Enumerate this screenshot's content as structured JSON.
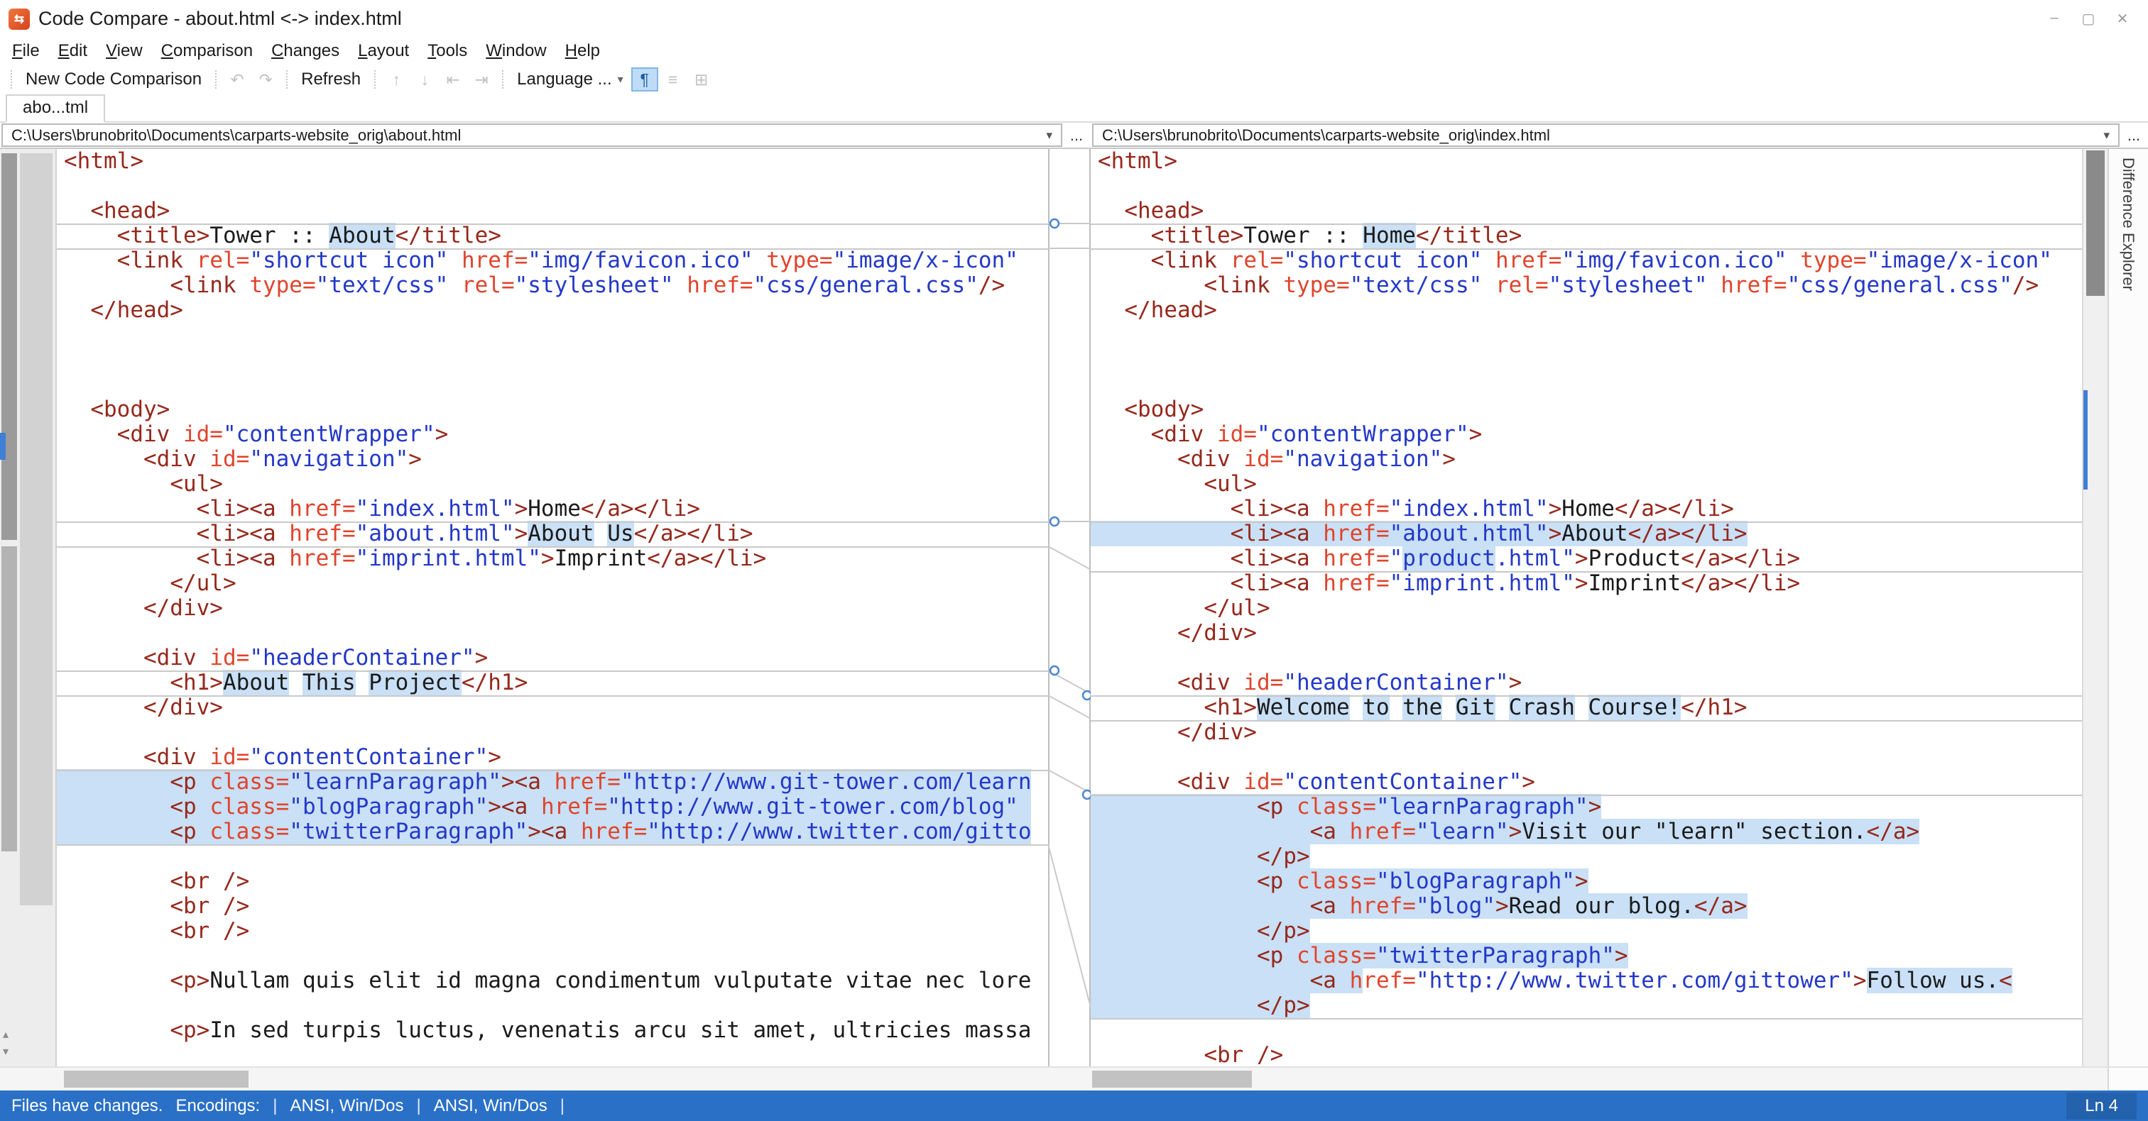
{
  "window": {
    "title": "Code Compare - about.html <-> index.html",
    "controls": [
      {
        "name": "minimize-button",
        "glyph": "–"
      },
      {
        "name": "maximize-button",
        "glyph": "▢"
      },
      {
        "name": "close-button",
        "glyph": "✕"
      }
    ]
  },
  "menu": [
    "File",
    "Edit",
    "View",
    "Comparison",
    "Changes",
    "Layout",
    "Tools",
    "Window",
    "Help"
  ],
  "toolbar": {
    "items": [
      {
        "type": "grip"
      },
      {
        "type": "label",
        "label": "New Code Comparison",
        "name": "new-code-comparison-button"
      },
      {
        "type": "grip"
      },
      {
        "type": "icon",
        "glyph": "↶",
        "name": "undo-icon",
        "state": "disabled"
      },
      {
        "type": "icon",
        "glyph": "↷",
        "name": "redo-icon",
        "state": "disabled"
      },
      {
        "type": "grip"
      },
      {
        "type": "label",
        "label": "Refresh",
        "name": "refresh-button"
      },
      {
        "type": "grip"
      },
      {
        "type": "icon",
        "glyph": "↑",
        "name": "previous-difference-icon",
        "state": "disabled"
      },
      {
        "type": "icon",
        "glyph": "↓",
        "name": "next-difference-icon",
        "state": "disabled"
      },
      {
        "type": "icon",
        "glyph": "⇤",
        "name": "first-difference-icon",
        "state": "disabled"
      },
      {
        "type": "icon",
        "glyph": "⇥",
        "name": "last-difference-icon",
        "state": "disabled"
      },
      {
        "type": "grip"
      },
      {
        "type": "label",
        "label": "Language ...",
        "name": "language-selector",
        "arrow": true
      },
      {
        "type": "icon",
        "glyph": "¶",
        "name": "show-whitespace-icon",
        "state": "active"
      },
      {
        "type": "icon",
        "glyph": "≡",
        "name": "line-details-icon",
        "state": "disabled"
      },
      {
        "type": "icon",
        "glyph": "⊞",
        "name": "structure-comparison-icon",
        "state": "disabled"
      }
    ]
  },
  "tabs": [
    {
      "label": "abo...tml"
    }
  ],
  "controls": {
    "browse_label": "...",
    "combo_arrow": "▾"
  },
  "left_pane": {
    "path": "C:\\Users\\brunobrito\\Documents\\carparts-website_orig\\about.html",
    "lines": [
      "<html>",
      "",
      "  <head>",
      {
        "t": "    <title>Tower :: About</title>",
        "hl": [
          {
            "find": "About"
          }
        ]
      },
      "    <link rel=\"shortcut icon\" href=\"img/favicon.ico\" type=\"image/x-icon\"",
      "        <link type=\"text/css\" rel=\"stylesheet\" href=\"css/general.css\"/>",
      "  </head>",
      "",
      "",
      "",
      "  <body>",
      "    <div id=\"contentWrapper\">",
      "      <div id=\"navigation\">",
      "        <ul>",
      "          <li><a href=\"index.html\">Home</a></li>",
      {
        "t": "          <li><a href=\"about.html\">About Us</a></li>",
        "hl": [
          {
            "words": [
              "About",
              "Us"
            ]
          }
        ]
      },
      "          <li><a href=\"imprint.html\">Imprint</a></li>",
      "        </ul>",
      "      </div>",
      "",
      "      <div id=\"headerContainer\">",
      {
        "t": "        <h1>About This Project</h1>",
        "hl": [
          {
            "words": [
              "About",
              "This",
              "Project"
            ]
          }
        ]
      },
      "      </div>",
      "",
      "      <div id=\"contentContainer\">",
      {
        "t": "        <p class=\"learnParagraph\"><a href=\"http://www.git-tower.com/learn",
        "hl": [
          {
            "full": true
          }
        ]
      },
      {
        "t": "        <p class=\"blogParagraph\"><a href=\"http://www.git-tower.com/blog\" ",
        "hl": [
          {
            "full": true
          }
        ]
      },
      {
        "t": "        <p class=\"twitterParagraph\"><a href=\"http://www.twitter.com/gitto",
        "hl": [
          {
            "full": true
          }
        ]
      },
      "",
      "        <br />",
      "        <br />",
      "        <br />",
      "",
      "        <p>Nullam quis elit id magna condimentum vulputate vitae nec lore",
      "",
      "        <p>In sed turpis luctus, venenatis arcu sit amet, ultricies massa"
    ]
  },
  "right_pane": {
    "path": "C:\\Users\\brunobrito\\Documents\\carparts-website_orig\\index.html",
    "lines": [
      "<html>",
      "",
      "  <head>",
      {
        "t": "    <title>Tower :: Home</title>",
        "hl": [
          {
            "find": "Home"
          }
        ]
      },
      "    <link rel=\"shortcut icon\" href=\"img/favicon.ico\" type=\"image/x-icon\"",
      "        <link type=\"text/css\" rel=\"stylesheet\" href=\"css/general.css\"/>",
      "  </head>",
      "",
      "",
      "",
      "  <body>",
      "    <div id=\"contentWrapper\">",
      "      <div id=\"navigation\">",
      "        <ul>",
      "          <li><a href=\"index.html\">Home</a></li>",
      {
        "t": "          <li><a href=\"about.html\">About</a></li>",
        "hl": [
          {
            "full": true
          }
        ]
      },
      {
        "t": "          <li><a href=\"product.html\">Product</a></li>",
        "hl": [
          {
            "find": "product"
          }
        ]
      },
      "          <li><a href=\"imprint.html\">Imprint</a></li>",
      "        </ul>",
      "      </div>",
      "",
      "      <div id=\"headerContainer\">",
      {
        "t": "        <h1>Welcome to the Git Crash Course!</h1>",
        "hl": [
          {
            "words": [
              "Welcome",
              "to",
              "the",
              "Git",
              "Crash",
              "Course!"
            ]
          }
        ]
      },
      "      </div>",
      "",
      "      <div id=\"contentContainer\">",
      {
        "t": "            <p class=\"learnParagraph\">",
        "hl": [
          {
            "full": true
          }
        ]
      },
      {
        "t": "                <a href=\"learn\">Visit our \"learn\" section.</a>",
        "hl": [
          {
            "full": true
          }
        ]
      },
      {
        "t": "            </p>",
        "hl": [
          {
            "full": true
          }
        ]
      },
      {
        "t": "            <p class=\"blogParagraph\">",
        "hl": [
          {
            "full": true
          }
        ]
      },
      {
        "t": "                <a href=\"blog\">Read our blog.</a>",
        "hl": [
          {
            "full": true
          }
        ]
      },
      {
        "t": "            </p>",
        "hl": [
          {
            "full": true
          }
        ]
      },
      {
        "t": "            <p class=\"twitterParagraph\">",
        "hl": [
          {
            "full": true
          }
        ]
      },
      {
        "t": "                <a href=\"http://www.twitter.com/gittower\">Follow us.<",
        "hl": [
          {
            "range": [
              0,
              20
            ]
          },
          {
            "find": "Follow us.<"
          }
        ]
      },
      {
        "t": "            </p>",
        "hl": [
          {
            "full": true
          }
        ]
      },
      "",
      "        <br />"
    ]
  },
  "difference_explorer": {
    "label": "Difference Explorer"
  },
  "status_bar": {
    "message": "Files have changes.",
    "encodings_label": "Encodings:",
    "encodings": [
      "ANSI, Win/Dos",
      "ANSI, Win/Dos"
    ],
    "line_indicator": "Ln 4"
  },
  "colors": {
    "diff_highlight": "#c9e0f6",
    "status_bar": "#2a70c7",
    "syntax_tag": "#96281c",
    "syntax_attr": "#e0442c",
    "syntax_string": "#2338c8",
    "syntax_text": "#1b1b1b",
    "accent_blue": "#4a86cf"
  }
}
